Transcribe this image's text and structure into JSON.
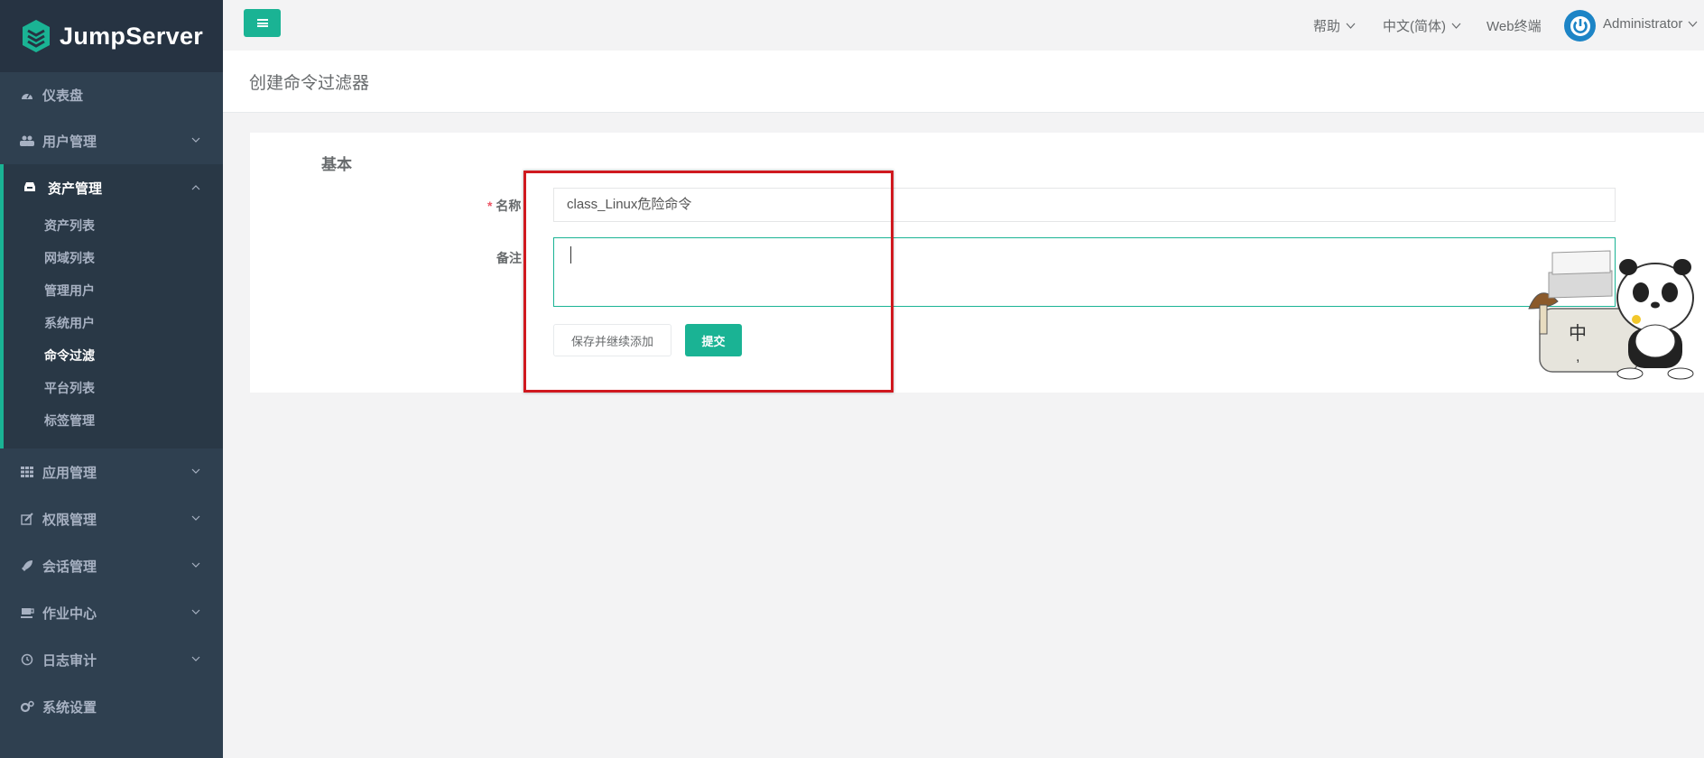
{
  "app": {
    "logo_text": "JumpServer"
  },
  "sidebar": {
    "items": [
      {
        "label": "仪表盘",
        "icon": "dashboard-icon"
      },
      {
        "label": "用户管理",
        "icon": "users-icon"
      },
      {
        "label": "资产管理",
        "icon": "inbox-icon",
        "expanded": true,
        "children": [
          "资产列表",
          "网域列表",
          "管理用户",
          "系统用户",
          "命令过滤",
          "平台列表",
          "标签管理"
        ],
        "active_child": "命令过滤"
      },
      {
        "label": "应用管理",
        "icon": "grid-icon"
      },
      {
        "label": "权限管理",
        "icon": "edit-icon"
      },
      {
        "label": "会话管理",
        "icon": "rocket-icon"
      },
      {
        "label": "作业中心",
        "icon": "coffee-icon"
      },
      {
        "label": "日志审计",
        "icon": "history-icon"
      },
      {
        "label": "系统设置",
        "icon": "gears-icon"
      }
    ]
  },
  "topbar": {
    "help": "帮助",
    "language": "中文(简体)",
    "web_terminal": "Web终端",
    "user": "Administrator"
  },
  "page": {
    "title": "创建命令过滤器",
    "section": "基本",
    "form": {
      "name_label": "名称",
      "name_required_mark": "*",
      "name_value": "class_Linux危险命令",
      "comment_label": "备注",
      "comment_value": ""
    },
    "buttons": {
      "save_continue": "保存并继续添加",
      "submit": "提交"
    }
  },
  "colors": {
    "sidebar_bg": "#2f4050",
    "accent": "#1ab394",
    "highlight_border": "#d0191f"
  }
}
